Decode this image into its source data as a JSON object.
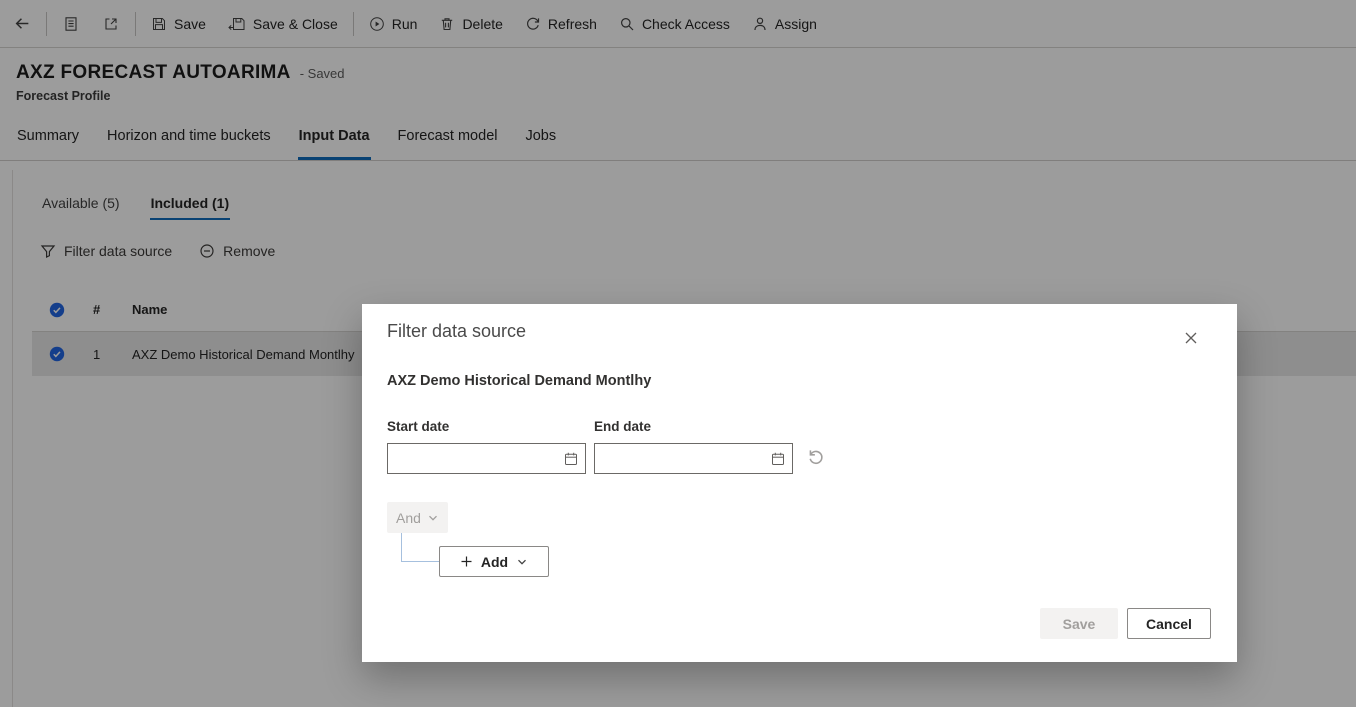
{
  "command_bar": {
    "save": "Save",
    "save_and_close": "Save & Close",
    "run": "Run",
    "delete": "Delete",
    "refresh": "Refresh",
    "check_access": "Check Access",
    "assign": "Assign"
  },
  "header": {
    "title": "AXZ FORECAST AUTOARIMA",
    "status": "- Saved",
    "record_type": "Forecast Profile"
  },
  "tabs": [
    {
      "label": "Summary",
      "active": false
    },
    {
      "label": "Horizon and time buckets",
      "active": false
    },
    {
      "label": "Input Data",
      "active": true
    },
    {
      "label": "Forecast model",
      "active": false
    },
    {
      "label": "Jobs",
      "active": false
    }
  ],
  "subtabs": [
    {
      "label": "Available (5)",
      "active": false
    },
    {
      "label": "Included (1)",
      "active": true
    }
  ],
  "grid_toolbar": {
    "filter_data_source": "Filter data source",
    "remove": "Remove"
  },
  "grid": {
    "columns": {
      "number": "#",
      "name": "Name"
    },
    "rows": [
      {
        "number": "1",
        "name": "AXZ Demo Historical Demand Montlhy",
        "selected": true
      }
    ]
  },
  "dialog": {
    "title": "Filter data source",
    "data_source": "AXZ Demo Historical Demand Montlhy",
    "start_date": {
      "label": "Start date",
      "value": ""
    },
    "end_date": {
      "label": "End date",
      "value": ""
    },
    "operator": "And",
    "add_label": "Add",
    "save_label": "Save",
    "save_enabled": false,
    "cancel_label": "Cancel"
  },
  "icons": {
    "back": "arrow-left",
    "form": "document-list",
    "popout": "open-in-new-window",
    "save": "floppy-disk",
    "save_and_close": "floppy-disk-with-arrow",
    "run": "play-circle",
    "delete": "trash-can",
    "refresh": "circular-arrow",
    "check_access": "magnifier",
    "assign": "person",
    "filter": "funnel",
    "remove": "minus-circle",
    "row_selected": "check-circle",
    "calendar": "calendar",
    "reset": "undo-arrow",
    "dropdown": "chevron-down",
    "add": "plus",
    "close": "x"
  },
  "colors": {
    "accent_blue": "#0f6cbd",
    "selection_check_blue": "#2266e3",
    "selected_row_background": "#e8e8e8",
    "overlay": "rgba(0,0,0,0.39)",
    "disabled_text": "#a19f9d"
  }
}
